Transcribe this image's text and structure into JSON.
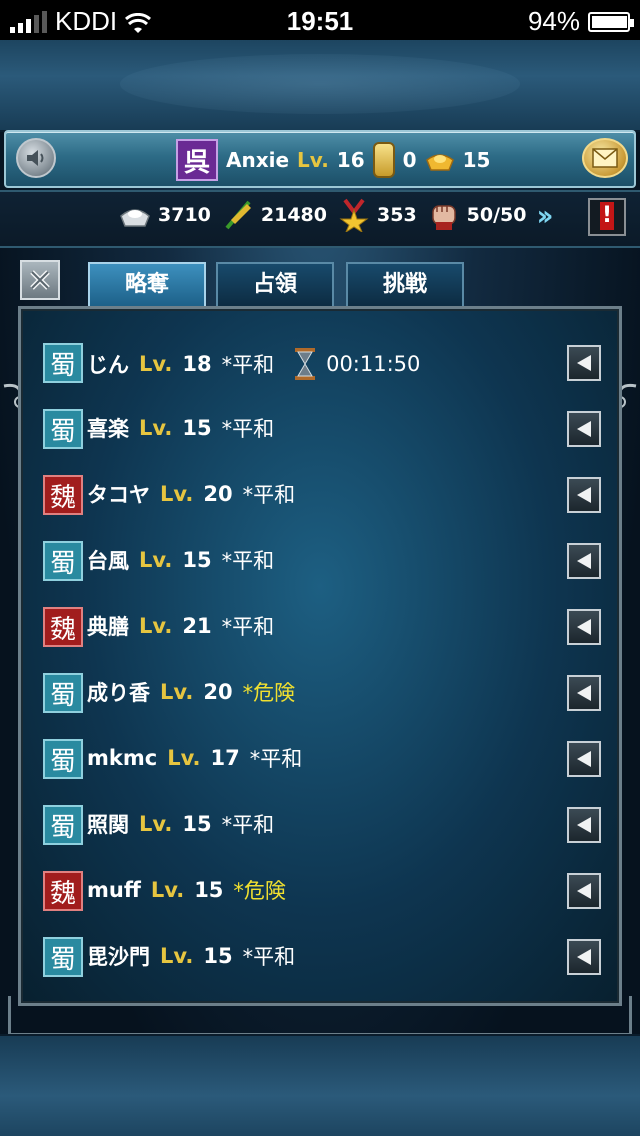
{
  "status_bar": {
    "carrier": "KDDI",
    "time": "19:51",
    "battery": "94%",
    "battery_level": 0.94
  },
  "header": {
    "kingdom_badge": "呉",
    "player_name": "Anxie",
    "level_label": "Lv.",
    "level": "16",
    "gold": "0",
    "ingots": "15"
  },
  "resources": {
    "silver": "3710",
    "food": "21480",
    "medals": "353",
    "stamina": "50/50"
  },
  "tabs": [
    {
      "label": "略奪",
      "active": true
    },
    {
      "label": "占領",
      "active": false
    },
    {
      "label": "挑戦",
      "active": false
    }
  ],
  "players": [
    {
      "kingdom": "shu",
      "badge": "蜀",
      "name": "じん",
      "level": "18",
      "status": "*平和",
      "danger": false,
      "timer": "00:11:50"
    },
    {
      "kingdom": "shu",
      "badge": "蜀",
      "name": "喜楽",
      "level": "15",
      "status": "*平和",
      "danger": false
    },
    {
      "kingdom": "wei",
      "badge": "魏",
      "name": "タコヤ",
      "level": "20",
      "status": "*平和",
      "danger": false
    },
    {
      "kingdom": "shu",
      "badge": "蜀",
      "name": "台風",
      "level": "15",
      "status": "*平和",
      "danger": false
    },
    {
      "kingdom": "wei",
      "badge": "魏",
      "name": "典膳",
      "level": "21",
      "status": "*平和",
      "danger": false
    },
    {
      "kingdom": "shu",
      "badge": "蜀",
      "name": "成り香",
      "level": "20",
      "status": "*危険",
      "danger": true
    },
    {
      "kingdom": "shu",
      "badge": "蜀",
      "name": "mkmc",
      "level": "17",
      "status": "*平和",
      "danger": false
    },
    {
      "kingdom": "shu",
      "badge": "蜀",
      "name": "照関",
      "level": "15",
      "status": "*平和",
      "danger": false
    },
    {
      "kingdom": "wei",
      "badge": "魏",
      "name": "muff",
      "level": "15",
      "status": "*危険",
      "danger": true
    },
    {
      "kingdom": "shu",
      "badge": "蜀",
      "name": "毘沙門",
      "level": "15",
      "status": "*平和",
      "danger": false
    }
  ]
}
